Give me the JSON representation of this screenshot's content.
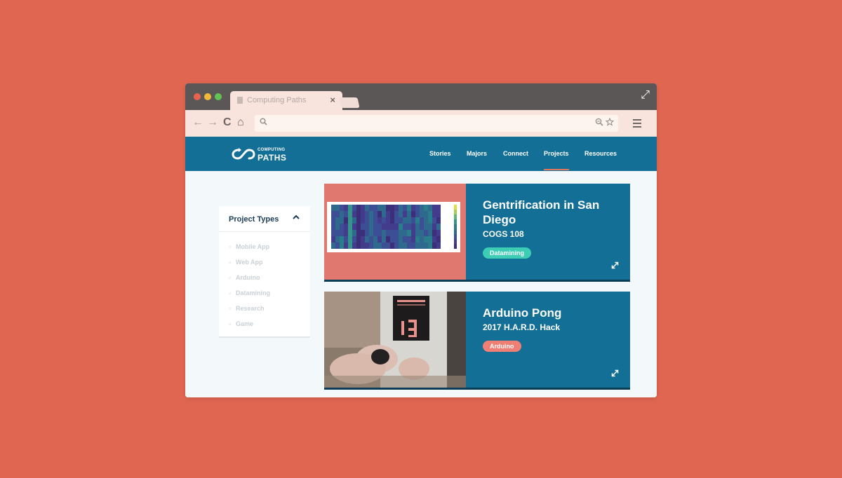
{
  "browser": {
    "tab_title": "Computing Paths",
    "tab_close": "×",
    "icons": [
      "file-icon",
      "close-icon",
      "expand-icon",
      "back-icon",
      "forward-icon",
      "reload-icon",
      "home-icon",
      "search-icon",
      "zoom-icon",
      "star-icon",
      "menu-icon"
    ],
    "buttons": {
      "back": "←",
      "forward": "→",
      "reload": "C",
      "home": "⌂",
      "expand": "⤢"
    },
    "url": ""
  },
  "site": {
    "logo_small": "COMPUTING",
    "logo_big": "PATHS",
    "nav": [
      "Stories",
      "Majors",
      "Connect",
      "Projects",
      "Resources"
    ],
    "active_nav": "Projects",
    "accent": "#136f96",
    "active_underline": "#e8765b"
  },
  "sidebar": {
    "title": "Project Types",
    "items": [
      "Mobile App",
      "Web App",
      "Arduino",
      "Datamining",
      "Research",
      "Game"
    ]
  },
  "projects": [
    {
      "title": "Gentrification in San Diego",
      "subtitle": "COGS 108",
      "tag": "Datamining",
      "tag_color": "#3ccdb4"
    },
    {
      "title": "Arduino Pong",
      "subtitle": "2017 H.A.R.D. Hack",
      "tag": "Arduino",
      "tag_color": "#ef7f74"
    }
  ]
}
